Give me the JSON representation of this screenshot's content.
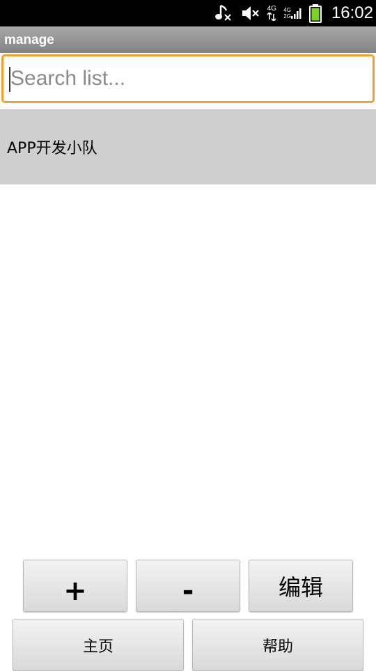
{
  "status_bar": {
    "time": "16:02",
    "network_top": "4G",
    "network_sub_a": "4G",
    "network_sub_b": "2G",
    "icons": [
      "music-muted-icon",
      "volume-muted-icon",
      "network-4g-icon",
      "signal-icon",
      "battery-icon"
    ]
  },
  "title_bar": {
    "title": "manage"
  },
  "search": {
    "placeholder": "Search list..."
  },
  "list": {
    "items": [
      {
        "label": "APP开发小队"
      }
    ]
  },
  "buttons": {
    "add_label": "+",
    "remove_label": "-",
    "edit_label": "编辑",
    "home_label": "主页",
    "help_label": "帮助"
  },
  "colors": {
    "search_focus_border": "#f0a030",
    "list_item_bg": "#cfcfcf",
    "battery": "#7cd321"
  }
}
